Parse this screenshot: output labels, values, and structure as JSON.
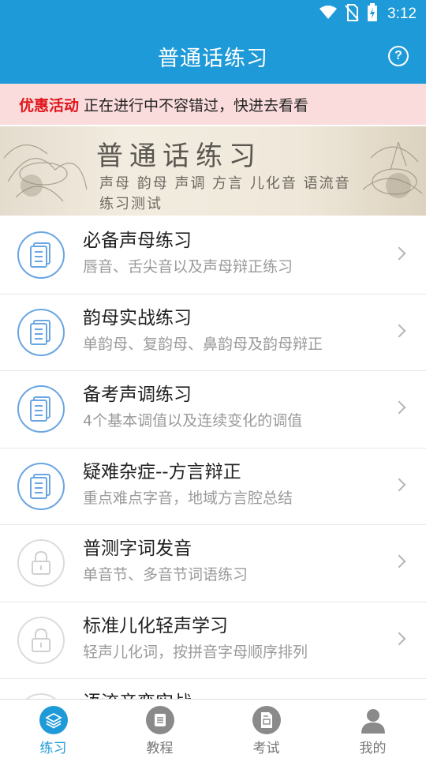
{
  "status_bar": {
    "time": "3:12",
    "icons": [
      "wifi-icon",
      "no-sim-icon",
      "battery-charging-icon"
    ]
  },
  "app_bar": {
    "title": "普通话练习",
    "help_icon": "help-icon",
    "help_glyph": "?"
  },
  "promo": {
    "tag": "优惠活动",
    "text": "正在进行中不容错过，快进去看看"
  },
  "banner": {
    "title": "普通话练习",
    "subtitle_line1": "声母 韵母 声调 方言 儿化音 语流音",
    "subtitle_line2": "练习测试"
  },
  "lessons": [
    {
      "title": "必备声母练习",
      "desc": "唇音、舌尖音以及声母辩正练习",
      "icon": "document-icon",
      "locked": false
    },
    {
      "title": "韵母实战练习",
      "desc": "单韵母、复韵母、鼻韵母及韵母辩正",
      "icon": "document-icon",
      "locked": false
    },
    {
      "title": "备考声调练习",
      "desc": "4个基本调值以及连续变化的调值",
      "icon": "document-icon",
      "locked": false
    },
    {
      "title": "疑难杂症--方言辩正",
      "desc": "重点难点字音，地域方言腔总结",
      "icon": "document-icon",
      "locked": false
    },
    {
      "title": "普测字词发音",
      "desc": "单音节、多音节词语练习",
      "icon": "lock-icon",
      "locked": true
    },
    {
      "title": "标准儿化轻声学习",
      "desc": "轻声儿化词，按拼音字母顺序排列",
      "icon": "lock-icon",
      "locked": true
    },
    {
      "title": "语流音变实战",
      "desc": "",
      "icon": "lock-icon",
      "locked": true
    }
  ],
  "bottom_nav": [
    {
      "label": "练习",
      "icon": "layers-icon",
      "active": true
    },
    {
      "label": "教程",
      "icon": "book-icon",
      "active": false
    },
    {
      "label": "考试",
      "icon": "exam-paper-icon",
      "active": false
    },
    {
      "label": "我的",
      "icon": "user-icon",
      "active": false
    }
  ],
  "colors": {
    "primary": "#1e9ad8",
    "promo_bg": "#fbdcdc",
    "promo_tag": "#e0161c",
    "icon_blue": "#6aa6e2"
  }
}
